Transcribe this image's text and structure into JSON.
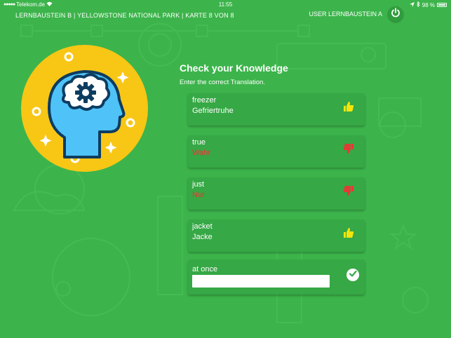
{
  "status_bar": {
    "carrier": "Telekom.de",
    "time": "11:55",
    "battery": "98 %"
  },
  "header": {
    "breadcrumb": "LERNBAUSTEIN B | YELLOWSTONE NATIONAL PARK | KARTE 8 VON 8",
    "user": "USER LERNBAUSTEIN A"
  },
  "quiz": {
    "title": "Check your Knowledge",
    "subtitle": "Enter the correct Translation.",
    "cards": [
      {
        "word": "freezer",
        "answer": "Gefriertruhe",
        "result": "correct"
      },
      {
        "word": "true",
        "answer": "Wahr",
        "result": "wrong"
      },
      {
        "word": "just",
        "answer": "Nur",
        "result": "wrong"
      },
      {
        "word": "jacket",
        "answer": "Jacke",
        "result": "correct"
      }
    ],
    "input_card": {
      "word": "at once",
      "value": ""
    }
  },
  "colors": {
    "background": "#3cb44b",
    "card": "#36a845",
    "brain_circle": "#f8c615",
    "head": "#4fc3f7",
    "thumb_up": "#f5e50a",
    "thumb_down": "#e53935"
  },
  "icons": {
    "wifi": "wifi-icon",
    "location": "location-arrow-icon",
    "bluetooth": "bluetooth-icon",
    "battery": "battery-icon",
    "power": "power-icon",
    "thumb_up": "thumbs-up-icon",
    "thumb_down": "thumbs-down-icon",
    "check": "check-icon",
    "brain": "brain-gear-head-icon"
  }
}
